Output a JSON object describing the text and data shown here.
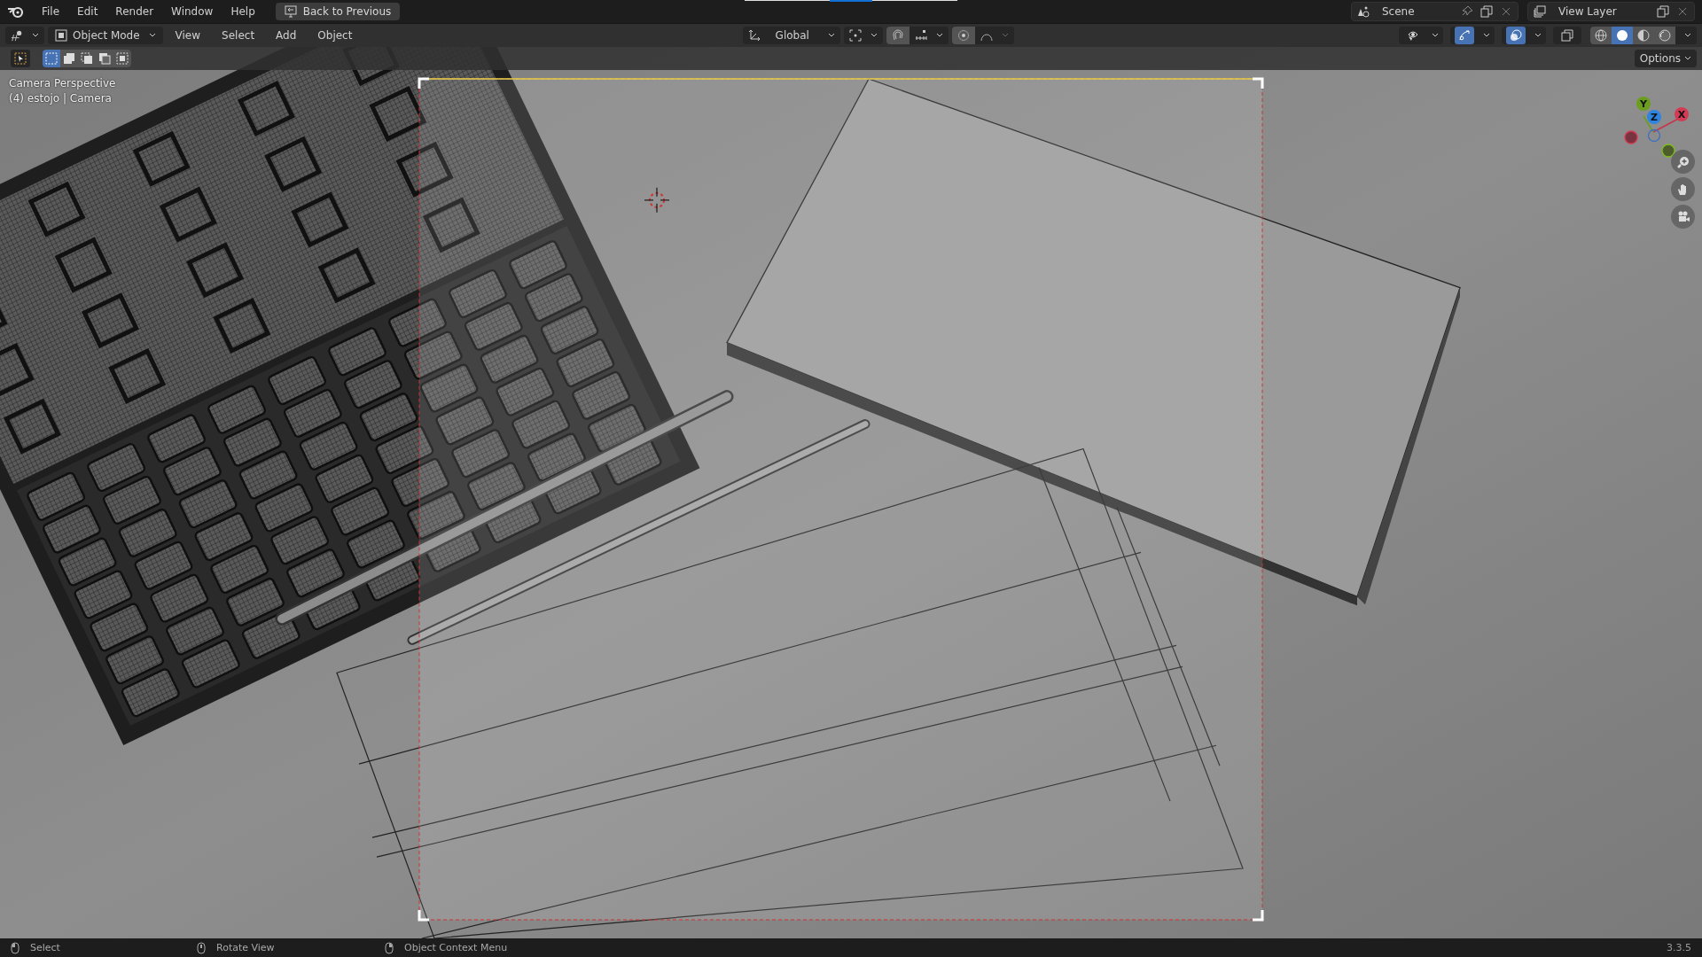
{
  "topbar": {
    "menus": [
      "File",
      "Edit",
      "Render",
      "Window",
      "Help"
    ],
    "back_button": "Back to Previous",
    "scene": "Scene",
    "view_layer": "View Layer"
  },
  "header": {
    "mode": "Object Mode",
    "menus": [
      "View",
      "Select",
      "Add",
      "Object"
    ],
    "orientation": "Global",
    "toggles": [
      {
        "kind": "visibility",
        "on": false
      },
      {
        "kind": "gizmo",
        "on": true
      },
      {
        "kind": "overlay",
        "on": true
      },
      {
        "kind": "xray",
        "on": false
      }
    ],
    "shading": [
      {
        "kind": "wireframe",
        "selected": false
      },
      {
        "kind": "solid",
        "selected": true
      },
      {
        "kind": "material",
        "selected": false
      },
      {
        "kind": "rendered",
        "selected": false
      }
    ]
  },
  "tool_row": {
    "select_modes": [
      {
        "selected": true
      },
      {
        "selected": false
      },
      {
        "selected": false
      },
      {
        "selected": false
      },
      {
        "selected": false
      }
    ],
    "options": "Options"
  },
  "viewport": {
    "view_name": "Camera Perspective",
    "object_info": "(4) estojo | Camera",
    "axes": [
      "X",
      "Y",
      "Z"
    ]
  },
  "status_bar": {
    "items": [
      {
        "kind": "left",
        "label": "Select"
      },
      {
        "kind": "middle",
        "label": "Rotate View"
      },
      {
        "kind": "right",
        "label": "Object Context Menu"
      }
    ],
    "version": "3.3.5"
  }
}
